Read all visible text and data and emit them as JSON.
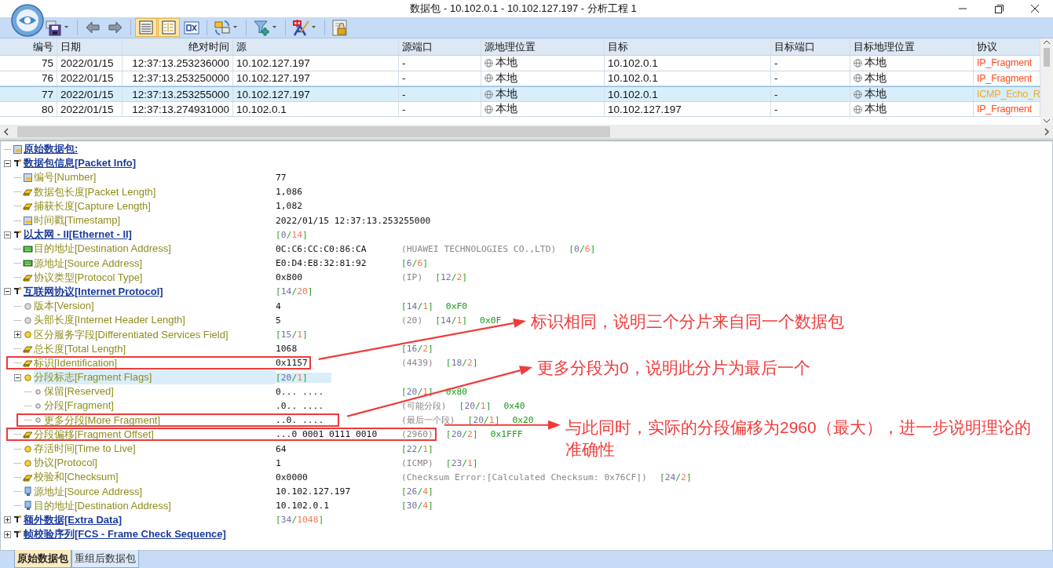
{
  "window": {
    "title": "数据包 - 10.102.0.1 - 10.102.127.197 - 分析工程 1"
  },
  "toolbar": [
    {
      "kind": "save",
      "dropdown": true,
      "selected": false
    },
    {
      "kind": "back",
      "dropdown": false,
      "selected": false
    },
    {
      "kind": "forward",
      "dropdown": false,
      "selected": false
    },
    {
      "kind": "list",
      "dropdown": false,
      "selected": true
    },
    {
      "kind": "detail",
      "dropdown": false,
      "selected": true
    },
    {
      "kind": "hex",
      "dropdown": false,
      "selected": false
    },
    {
      "kind": "convert",
      "dropdown": true,
      "selected": false
    },
    {
      "kind": "filter",
      "dropdown": true,
      "selected": false
    },
    {
      "kind": "translate",
      "dropdown": true,
      "selected": false
    },
    {
      "kind": "lock",
      "dropdown": false,
      "selected": false
    }
  ],
  "packets": {
    "columns": [
      {
        "label": "编号",
        "kind": "number"
      },
      {
        "label": "日期",
        "kind": "text"
      },
      {
        "label": "绝对时间",
        "kind": "number"
      },
      {
        "label": "源",
        "kind": "text"
      },
      {
        "label": "源端口",
        "kind": "text"
      },
      {
        "label": "源地理位置",
        "kind": "geo"
      },
      {
        "label": "目标",
        "kind": "text"
      },
      {
        "label": "目标端口",
        "kind": "text"
      },
      {
        "label": "目标地理位置",
        "kind": "geo"
      },
      {
        "label": "协议",
        "kind": "protocol"
      }
    ],
    "rows": [
      {
        "selected": false,
        "color": "#ff4a1a",
        "cells": [
          "75",
          "2022/01/15",
          "12:37:13.253236000",
          "10.102.127.197",
          "-",
          "本地",
          "10.102.0.1",
          "-",
          "本地",
          "IP_Fragment"
        ]
      },
      {
        "selected": false,
        "color": "#ff4a1a",
        "cells": [
          "76",
          "2022/01/15",
          "12:37:13.253250000",
          "10.102.127.197",
          "-",
          "本地",
          "10.102.0.1",
          "-",
          "本地",
          "IP_Fragment"
        ]
      },
      {
        "selected": true,
        "color": "#f5a623",
        "cells": [
          "77",
          "2022/01/15",
          "12:37:13.253255000",
          "10.102.127.197",
          "-",
          "本地",
          "10.102.0.1",
          "-",
          "本地",
          "ICMP_Echo_R"
        ]
      },
      {
        "selected": false,
        "color": "#ff4a1a",
        "cells": [
          "80",
          "2022/01/15",
          "12:37:13.274931000",
          "10.102.0.1",
          "-",
          "本地",
          "10.102.127.197",
          "-",
          "本地",
          "IP_Fragment"
        ]
      }
    ]
  },
  "tree": [
    {
      "label": "原始数据包:",
      "kind": "root",
      "selected": false
    },
    {
      "label": "数据包信息[Packet Info]",
      "kind": "section",
      "expanded": true,
      "selected": false,
      "children": [
        {
          "label": "编号[Number]",
          "kind": "record",
          "value": "77",
          "selected": false
        },
        {
          "label": "数据包长度[Packet Length]",
          "kind": "bytes",
          "value": "1,086",
          "selected": false
        },
        {
          "label": "捕获长度[Capture Length]",
          "kind": "bytes",
          "value": "1,082",
          "selected": false
        },
        {
          "label": "时间戳[Timestamp]",
          "kind": "record",
          "value": "2022/01/15 12:37:13.253255000",
          "selected": false
        }
      ]
    },
    {
      "label": "以太网 - II[Ethernet - II]",
      "kind": "section",
      "expanded": true,
      "selected": false,
      "extras": [
        {
          "kind": "range",
          "text": "[0/14]"
        }
      ],
      "children": [
        {
          "label": "目的地址[Destination Address]",
          "kind": "hardware_address",
          "value": "0C:C6:CC:C0:86:CA",
          "selected": false,
          "extras": [
            {
              "kind": "note",
              "text": "(HUAWEI TECHNOLOGIES CO.,LTD)"
            },
            {
              "kind": "range",
              "text": "[0/6]"
            }
          ]
        },
        {
          "label": "源地址[Source Address]",
          "kind": "hardware_address",
          "value": "E0:D4:E8:32:81:92",
          "selected": false,
          "extras": [
            {
              "kind": "range",
              "text": "[6/6]"
            }
          ]
        },
        {
          "label": "协议类型[Protocol Type]",
          "kind": "bytes",
          "value": "0x800",
          "selected": false,
          "extras": [
            {
              "kind": "note",
              "text": "(IP)"
            },
            {
              "kind": "range",
              "text": "[12/2]"
            }
          ]
        }
      ]
    },
    {
      "label": "互联网协议[Internet Protocol]",
      "kind": "section",
      "expanded": true,
      "selected": false,
      "extras": [
        {
          "kind": "range",
          "text": "[14/20]"
        }
      ],
      "children": [
        {
          "label": "版本[Version]",
          "kind": "bits",
          "value": "4",
          "selected": false,
          "extras": [
            {
              "kind": "range",
              "text": "[14/1]"
            },
            {
              "kind": "mask",
              "text": "0xF0"
            }
          ]
        },
        {
          "label": "头部长度[Internet Header Length]",
          "kind": "bits",
          "value": "5",
          "selected": false,
          "extras": [
            {
              "kind": "note",
              "text": "(20)"
            },
            {
              "kind": "range",
              "text": "[14/1]"
            },
            {
              "kind": "mask",
              "text": "0x0F"
            }
          ]
        },
        {
          "label": "区分服务字段[Differentiated Services Field]",
          "kind": "byte",
          "expanded": false,
          "selected": false,
          "extras": [
            {
              "kind": "range",
              "text": "[15/1]"
            }
          ]
        },
        {
          "label": "总长度[Total Length]",
          "kind": "bytes",
          "value": "1068",
          "selected": false,
          "extras": [
            {
              "kind": "range",
              "text": "[16/2]"
            }
          ]
        },
        {
          "label": "标识[Identification]",
          "kind": "bytes",
          "value": "0x1157",
          "selected": false,
          "boxed": true,
          "extras": [
            {
              "kind": "note",
              "text": "(4439)"
            },
            {
              "kind": "range",
              "text": "[18/2]"
            }
          ]
        },
        {
          "label": "分段标志[Fragment Flags]",
          "kind": "byte",
          "expanded": true,
          "selected": true,
          "extras": [
            {
              "kind": "range",
              "text": "[20/1]"
            }
          ],
          "children": [
            {
              "label": "保留[Reserved]",
              "kind": "flag",
              "value": "0... ....",
              "selected": false,
              "extras": [
                {
                  "kind": "range",
                  "text": "[20/1]"
                },
                {
                  "kind": "mask",
                  "text": "0x80"
                }
              ]
            },
            {
              "label": "分段[Fragment]",
              "kind": "flag",
              "value": ".0.. ....",
              "selected": false,
              "extras": [
                {
                  "kind": "note",
                  "text": "(可能分段)"
                },
                {
                  "kind": "range",
                  "text": "[20/1]"
                },
                {
                  "kind": "mask",
                  "text": "0x40"
                }
              ]
            },
            {
              "label": "更多分段[More Fragment]",
              "kind": "flag",
              "value": "..0. ....",
              "selected": false,
              "boxed": true,
              "extras": [
                {
                  "kind": "note",
                  "text": "(最后一个段)"
                },
                {
                  "kind": "range",
                  "text": "[20/1]"
                },
                {
                  "kind": "mask",
                  "text": "0x20"
                }
              ]
            }
          ]
        },
        {
          "label": "分段偏移[Fragment Offset]",
          "kind": "bytes",
          "value": "...0 0001 0111 0010",
          "selected": false,
          "boxed": true,
          "box_includes_note": true,
          "extras": [
            {
              "kind": "note",
              "text": "(2960)"
            },
            {
              "kind": "range",
              "text": "[20/2]"
            },
            {
              "kind": "mask",
              "text": "0x1FFF"
            }
          ]
        },
        {
          "label": "存活时间[Time to Live]",
          "kind": "byte",
          "value": "64",
          "selected": false,
          "extras": [
            {
              "kind": "range",
              "text": "[22/1]"
            }
          ]
        },
        {
          "label": "协议[Protocol]",
          "kind": "byte",
          "value": "1",
          "selected": false,
          "extras": [
            {
              "kind": "note",
              "text": "(ICMP)"
            },
            {
              "kind": "range",
              "text": "[23/1]"
            }
          ]
        },
        {
          "label": "校验和[Checksum]",
          "kind": "bytes",
          "value": "0x0000",
          "selected": false,
          "extras": [
            {
              "kind": "note",
              "text": "(Checksum Error:[Calculated Checksum: 0x76CF])"
            },
            {
              "kind": "range",
              "text": "[24/2]"
            }
          ]
        },
        {
          "label": "源地址[Source Address]",
          "kind": "ip_address",
          "value": "10.102.127.197",
          "selected": false,
          "extras": [
            {
              "kind": "range",
              "text": "[26/4]"
            }
          ]
        },
        {
          "label": "目的地址[Destination Address]",
          "kind": "ip_address",
          "value": "10.102.0.1",
          "selected": false,
          "extras": [
            {
              "kind": "range",
              "text": "[30/4]"
            }
          ]
        }
      ]
    },
    {
      "label": "额外数据[Extra Data]",
      "kind": "section",
      "expanded": false,
      "selected": false,
      "extras": [
        {
          "kind": "range",
          "text": "[34/1048]"
        }
      ]
    },
    {
      "label": "帧校验序列[FCS - Frame Check Sequence]",
      "kind": "section",
      "expanded": false,
      "selected": false
    }
  ],
  "annotations": [
    {
      "text": "标识相同，说明三个分片来自同一个数据包"
    },
    {
      "text": "更多分段为0，说明此分片为最后一个"
    },
    {
      "text": "与此同时，实际的分段偏移为2960（最大），进一步说明理论的准确性"
    }
  ],
  "tabs": [
    {
      "label": "原始数据包",
      "selected": true
    },
    {
      "label": "重组后数据包",
      "selected": false
    }
  ]
}
